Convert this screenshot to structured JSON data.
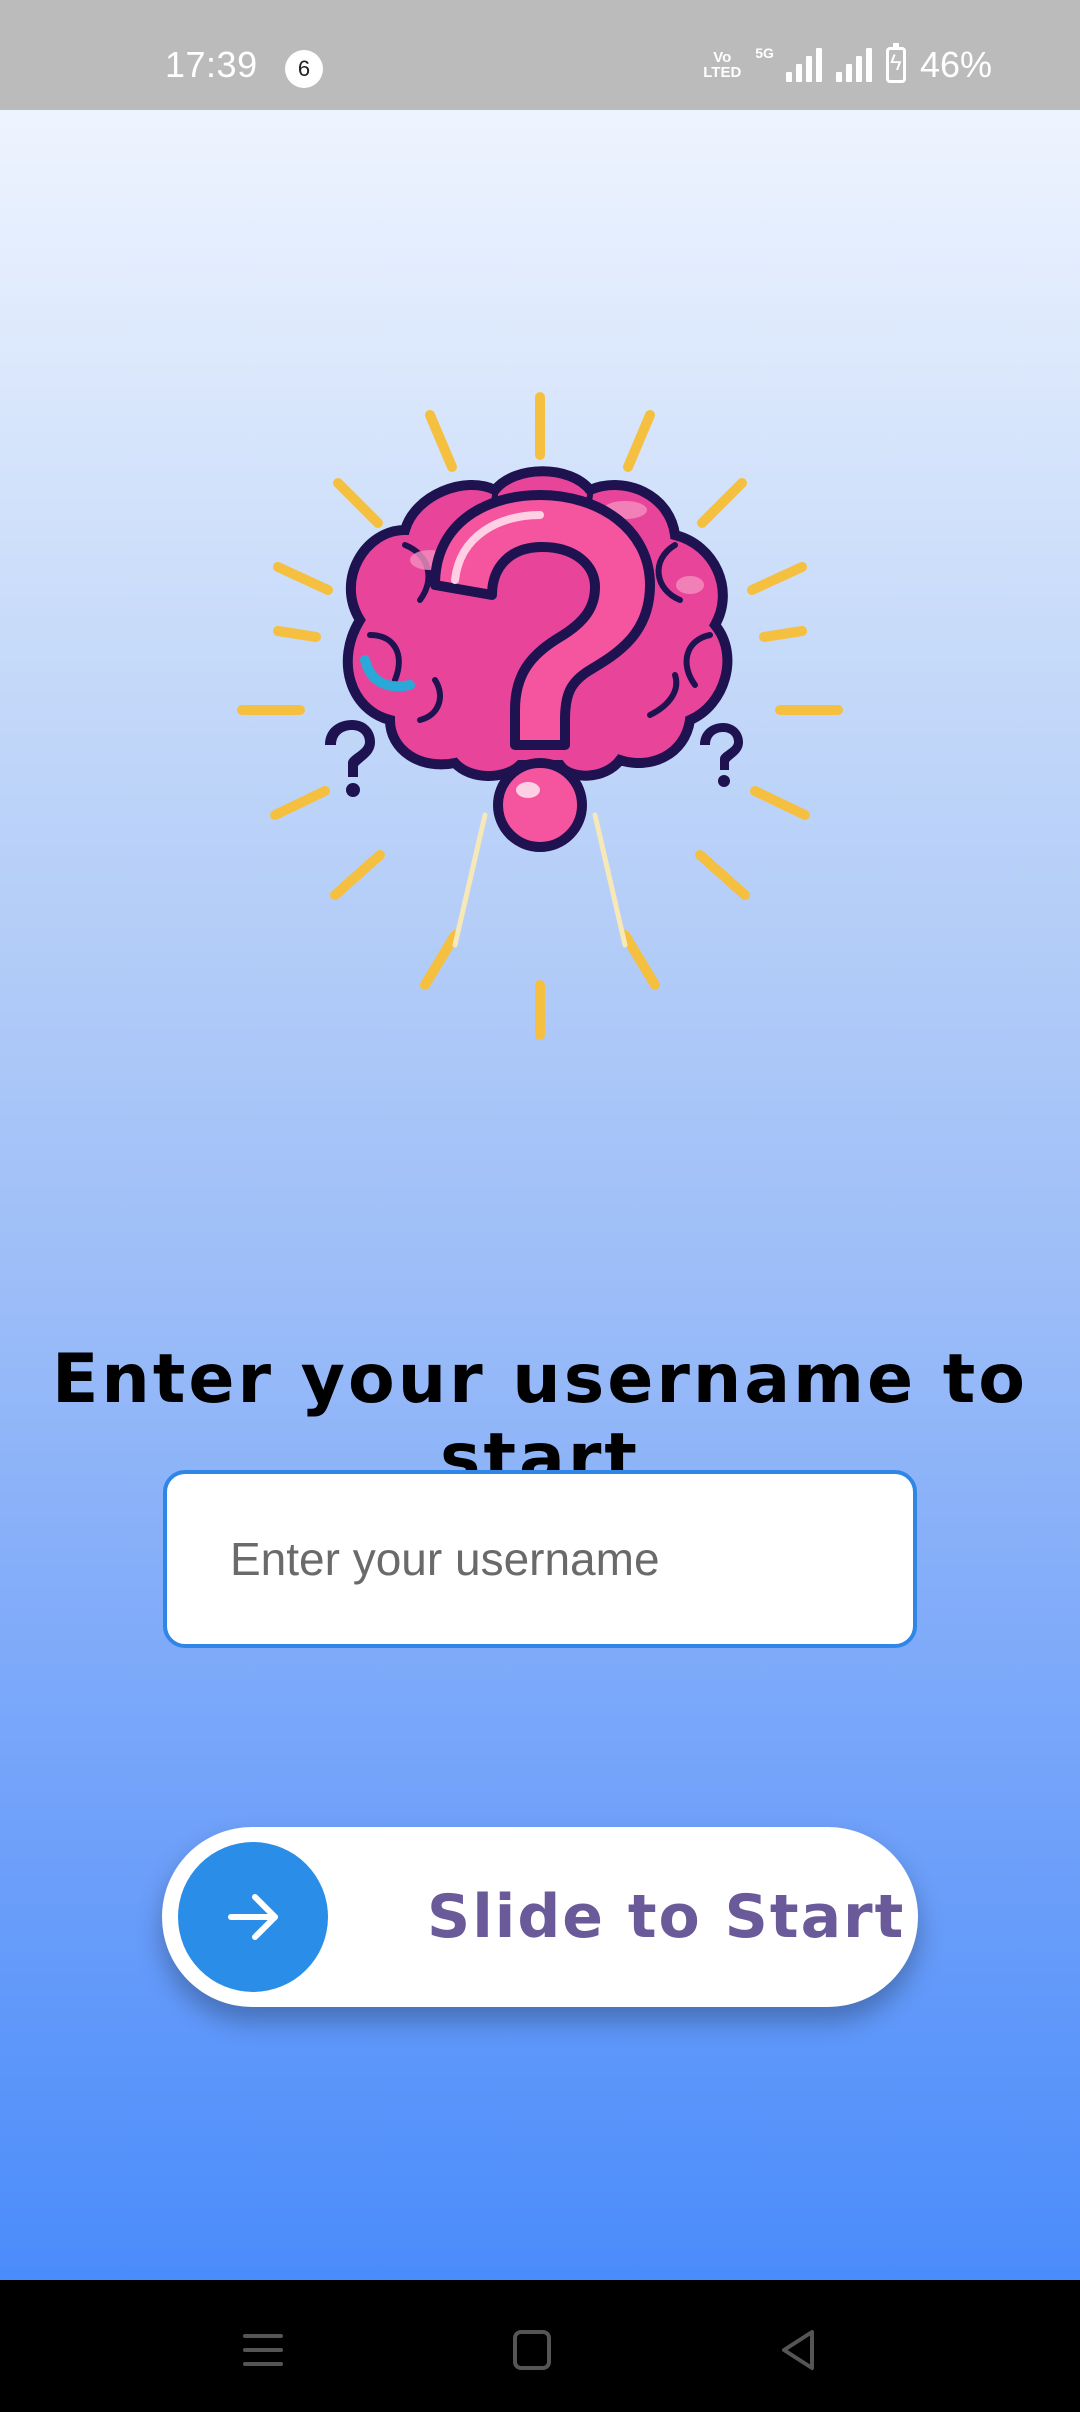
{
  "status_bar": {
    "time": "17:39",
    "notification_count": "6",
    "volte_label": "Vo\nLTED",
    "network": "5G",
    "battery": "46%"
  },
  "main": {
    "logo_icon": "brain-question-mark-icon",
    "heading": "Enter your username to start",
    "username_input": {
      "placeholder": "Enter your username",
      "value": ""
    },
    "slider": {
      "label": "Slide to Start",
      "icon": "arrow-right-icon"
    }
  },
  "nav_bar": {
    "icons": [
      "menu-icon",
      "home-icon",
      "back-icon"
    ]
  },
  "colors": {
    "accent": "#2a8ee8",
    "slider_text": "#6a5a9a",
    "brain_pink": "#f0509a",
    "rays": "#f5c040"
  }
}
